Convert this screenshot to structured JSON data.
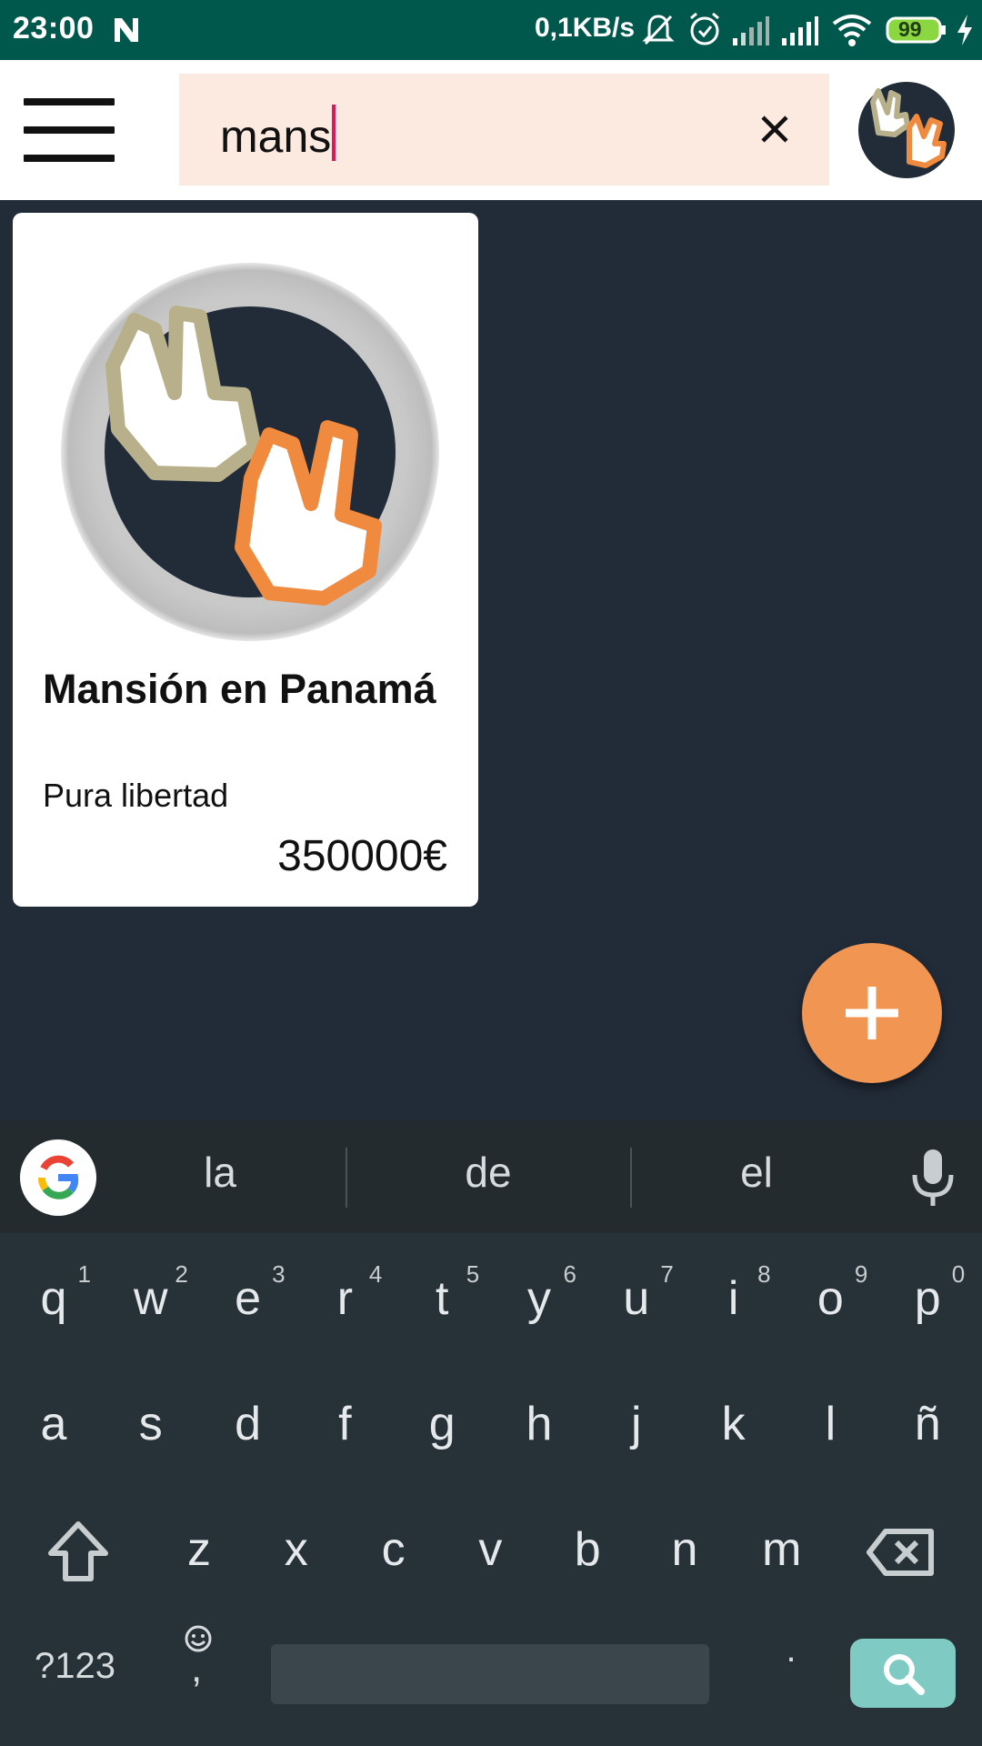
{
  "status_bar": {
    "time": "23:00",
    "network_speed": "0,1KB/s",
    "battery_level": "99",
    "icons": [
      "n-notification-icon",
      "bell-off-icon",
      "alarm-icon",
      "signal-icon",
      "signal-icon",
      "wifi-icon",
      "battery-icon",
      "charging-bolt-icon"
    ]
  },
  "app_bar": {
    "menu_icon": "hamburger-menu-icon",
    "search": {
      "value": "mans",
      "clear_icon": "close-icon"
    },
    "avatar_icon": "hands-peace-logo"
  },
  "results": [
    {
      "title": "Mansión en Panamá",
      "subtitle": "Pura libertad",
      "price": "350000€",
      "image_icon": "hands-peace-logo"
    }
  ],
  "fab": {
    "icon": "plus-icon"
  },
  "keyboard": {
    "suggestions": [
      "la",
      "de",
      "el"
    ],
    "row1": [
      {
        "ch": "q",
        "hint": "1"
      },
      {
        "ch": "w",
        "hint": "2"
      },
      {
        "ch": "e",
        "hint": "3"
      },
      {
        "ch": "r",
        "hint": "4"
      },
      {
        "ch": "t",
        "hint": "5"
      },
      {
        "ch": "y",
        "hint": "6"
      },
      {
        "ch": "u",
        "hint": "7"
      },
      {
        "ch": "i",
        "hint": "8"
      },
      {
        "ch": "o",
        "hint": "9"
      },
      {
        "ch": "p",
        "hint": "0"
      }
    ],
    "row2": [
      "a",
      "s",
      "d",
      "f",
      "g",
      "h",
      "j",
      "k",
      "l",
      "ñ"
    ],
    "row3": [
      "z",
      "x",
      "c",
      "v",
      "b",
      "n",
      "m"
    ],
    "symbols_label": "?123",
    "period_label": ".",
    "emoji_comma_label": ",",
    "colors": {
      "background": "#263238",
      "search_key": "#7fcbc4",
      "fab": "#f19552"
    }
  }
}
